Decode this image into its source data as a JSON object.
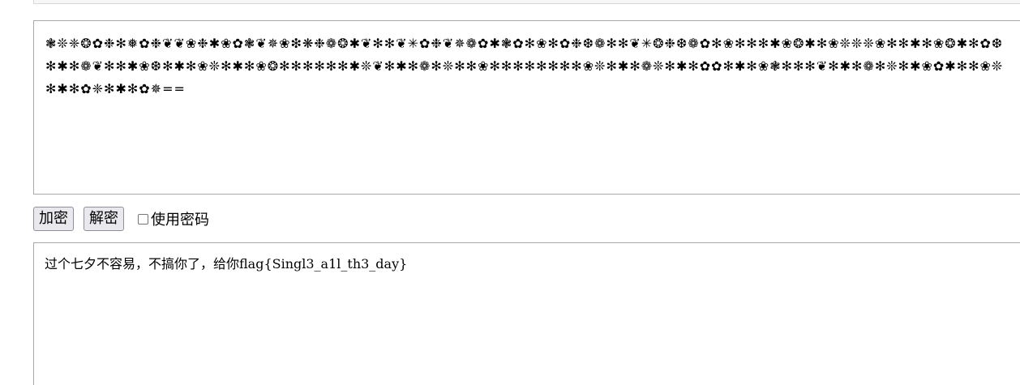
{
  "input": {
    "ciphertext": "❃❊❈❂✿❉✻❅✿❉❦❦❀❉✱❀✿❃❦✵❀❇❋❉❁❂✱❦✻✻❦✳✿❉❦✵❁✿✱❃✿✻❀✻✿❉❆❁✻✻❦✳❂❉❆❁✿✻❀✻✻✻✱❀❂✱✻❀❊❊❊❀✻✻✱✻❀❂✱✻✿❆✻✱✻❁❦✻✻✱❀❆✻✱✻❀❊✻✱✻❀❂✻✻✻✻✻✻✱❊❦✻✱✻❁✻❊✻✻❀✻✻✻✻✻✻✻✻❀❊✻✱✻❁❊✻✱✻✿✿✻✱✻❀❃✻✻✻❦✻✱✻❁✻❊✻✱❀✿✱✻✻❀❊✻✱✻✿❈✻✱✻✿✵=="
  },
  "controls": {
    "encrypt_label": "加密",
    "decrypt_label": "解密",
    "use_password_label": "使用密码",
    "use_password_checked": false
  },
  "output": {
    "text": "过个七夕不容易，不搞你了，给你flag{Singl3_a1l_th3_day}"
  }
}
